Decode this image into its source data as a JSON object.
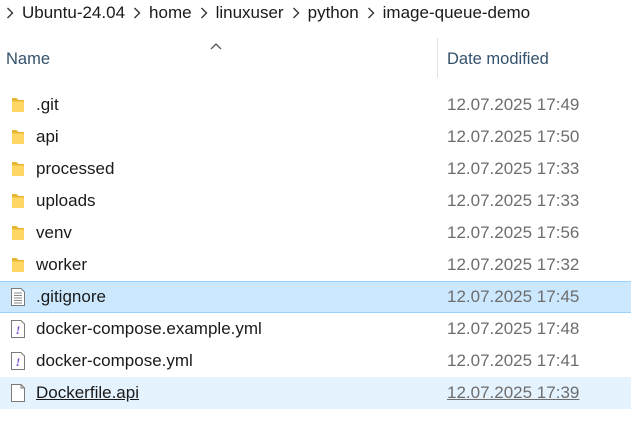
{
  "breadcrumb": {
    "items": [
      "Ubuntu-24.04",
      "home",
      "linuxuser",
      "python",
      "image-queue-demo"
    ]
  },
  "header": {
    "name_label": "Name",
    "date_label": "Date modified",
    "sort_icon": "chevron-up-icon"
  },
  "files": [
    {
      "name": ".git",
      "date": "12.07.2025 17:49",
      "type": "folder",
      "icon": "folder-icon"
    },
    {
      "name": "api",
      "date": "12.07.2025 17:50",
      "type": "folder",
      "icon": "folder-icon"
    },
    {
      "name": "processed",
      "date": "12.07.2025 17:33",
      "type": "folder",
      "icon": "folder-icon"
    },
    {
      "name": "uploads",
      "date": "12.07.2025 17:33",
      "type": "folder",
      "icon": "folder-icon"
    },
    {
      "name": "venv",
      "date": "12.07.2025 17:56",
      "type": "folder",
      "icon": "folder-icon"
    },
    {
      "name": "worker",
      "date": "12.07.2025 17:32",
      "type": "folder",
      "icon": "folder-icon"
    },
    {
      "name": ".gitignore",
      "date": "12.07.2025 17:45",
      "type": "text-file",
      "icon": "text-file-icon",
      "state": "selected"
    },
    {
      "name": "docker-compose.example.yml",
      "date": "12.07.2025 17:48",
      "type": "yml-file",
      "icon": "yml-file-icon"
    },
    {
      "name": "docker-compose.yml",
      "date": "12.07.2025 17:41",
      "type": "yml-file",
      "icon": "yml-file-icon"
    },
    {
      "name": "Dockerfile.api",
      "date": "12.07.2025 17:39",
      "type": "blank-file",
      "icon": "blank-file-icon",
      "state": "hovered"
    }
  ],
  "colors": {
    "selected_bg": "#cce8ff",
    "hover_bg": "#e5f3ff",
    "folder_yellow": "#ffd766",
    "header_text": "#34516c"
  }
}
